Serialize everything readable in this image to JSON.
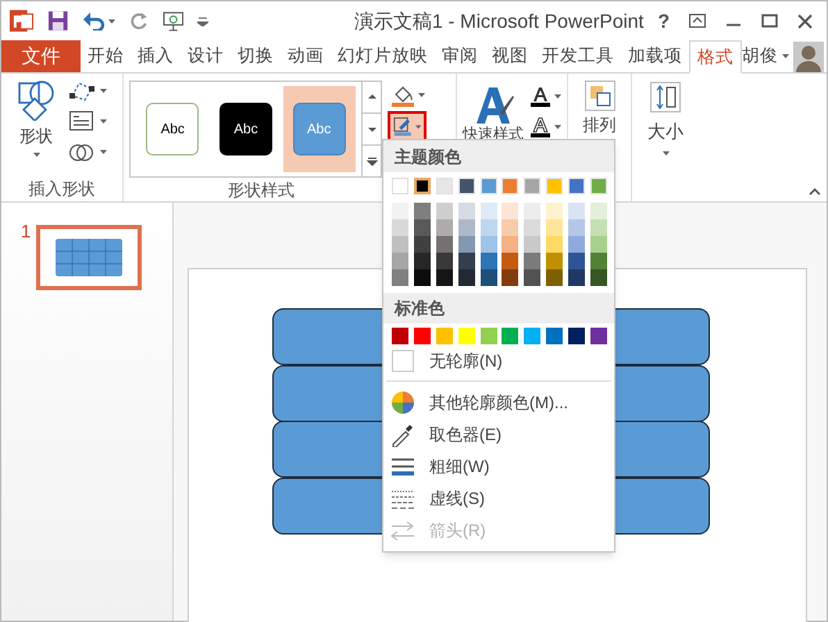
{
  "window": {
    "title": "演示文稿1 - Microsoft PowerPoint",
    "help": "?"
  },
  "ribbon_tabs": [
    {
      "label": "文件",
      "kind": "file",
      "selected": false
    },
    {
      "label": "开始",
      "kind": "tab",
      "selected": false
    },
    {
      "label": "插入",
      "kind": "tab",
      "selected": false
    },
    {
      "label": "设计",
      "kind": "tab",
      "selected": false
    },
    {
      "label": "切换",
      "kind": "tab",
      "selected": false
    },
    {
      "label": "动画",
      "kind": "tab",
      "selected": false
    },
    {
      "label": "幻灯片放映",
      "kind": "tab",
      "selected": false
    },
    {
      "label": "审阅",
      "kind": "tab",
      "selected": false
    },
    {
      "label": "视图",
      "kind": "tab",
      "selected": false
    },
    {
      "label": "开发工具",
      "kind": "tab",
      "selected": false
    },
    {
      "label": "加载项",
      "kind": "tab",
      "selected": false
    },
    {
      "label": "格式",
      "kind": "tab",
      "selected": true
    }
  ],
  "account": {
    "name": "胡俊"
  },
  "insert_shapes": {
    "button": "形状",
    "group": "插入形状"
  },
  "shape_styles": {
    "group": "形状样式",
    "gallery": [
      {
        "text": "Abc",
        "kind": "outline",
        "selected": false
      },
      {
        "text": "Abc",
        "kind": "dark",
        "selected": false
      },
      {
        "text": "Abc",
        "kind": "blue",
        "selected": true
      }
    ],
    "outline_button": {
      "expanded": true
    }
  },
  "quick_styles": {
    "label": "快速样式"
  },
  "arrange": {
    "label": "排列"
  },
  "size": {
    "label": "大小"
  },
  "outline_menu": {
    "theme_header": "主题颜色",
    "standard_header": "标准色",
    "theme_colors": [
      {
        "color": "#ffffff",
        "selected": false,
        "shades": [
          {
            "color": "#f2f2f2"
          },
          {
            "color": "#d9d9d9"
          },
          {
            "color": "#bfbfbf"
          },
          {
            "color": "#a6a6a6"
          },
          {
            "color": "#808080"
          }
        ]
      },
      {
        "color": "#000000",
        "selected": true,
        "shades": [
          {
            "color": "#7f7f7f"
          },
          {
            "color": "#595959"
          },
          {
            "color": "#404040"
          },
          {
            "color": "#262626"
          },
          {
            "color": "#0d0d0d"
          }
        ]
      },
      {
        "color": "#e7e6e6",
        "selected": false,
        "shades": [
          {
            "color": "#d0cece"
          },
          {
            "color": "#aeabab"
          },
          {
            "color": "#757171"
          },
          {
            "color": "#3b3838"
          },
          {
            "color": "#171616"
          }
        ]
      },
      {
        "color": "#44546a",
        "selected": false,
        "shades": [
          {
            "color": "#d6dce4"
          },
          {
            "color": "#adb9ca"
          },
          {
            "color": "#8497b0"
          },
          {
            "color": "#333f4f"
          },
          {
            "color": "#222a35"
          }
        ]
      },
      {
        "color": "#5b9bd5",
        "selected": false,
        "shades": [
          {
            "color": "#deebf6"
          },
          {
            "color": "#bdd7ee"
          },
          {
            "color": "#9dc3e6"
          },
          {
            "color": "#2e75b5"
          },
          {
            "color": "#1f4e79"
          }
        ]
      },
      {
        "color": "#ed7d31",
        "selected": false,
        "shades": [
          {
            "color": "#fbe5d5"
          },
          {
            "color": "#f7cbac"
          },
          {
            "color": "#f4b183"
          },
          {
            "color": "#c55a11"
          },
          {
            "color": "#833c0b"
          }
        ]
      },
      {
        "color": "#a5a5a5",
        "selected": false,
        "shades": [
          {
            "color": "#ededed"
          },
          {
            "color": "#dbdbdb"
          },
          {
            "color": "#c9c9c9"
          },
          {
            "color": "#7b7b7b"
          },
          {
            "color": "#525252"
          }
        ]
      },
      {
        "color": "#ffc000",
        "selected": false,
        "shades": [
          {
            "color": "#fff2cc"
          },
          {
            "color": "#fee599"
          },
          {
            "color": "#ffd965"
          },
          {
            "color": "#bf9000"
          },
          {
            "color": "#7f6000"
          }
        ]
      },
      {
        "color": "#4472c4",
        "selected": false,
        "shades": [
          {
            "color": "#dae3f3"
          },
          {
            "color": "#b4c7e7"
          },
          {
            "color": "#8faadc"
          },
          {
            "color": "#2f5496"
          },
          {
            "color": "#1f3864"
          }
        ]
      },
      {
        "color": "#70ad47",
        "selected": false,
        "shades": [
          {
            "color": "#e2efd9"
          },
          {
            "color": "#c5e0b3"
          },
          {
            "color": "#a8d08d"
          },
          {
            "color": "#538135"
          },
          {
            "color": "#375623"
          }
        ]
      }
    ],
    "standard_colors": [
      {
        "color": "#c00000"
      },
      {
        "color": "#ff0000"
      },
      {
        "color": "#ffc000"
      },
      {
        "color": "#ffff00"
      },
      {
        "color": "#92d050"
      },
      {
        "color": "#00b050"
      },
      {
        "color": "#00b0f0"
      },
      {
        "color": "#0070c0"
      },
      {
        "color": "#002060"
      },
      {
        "color": "#7030a0"
      }
    ],
    "items": [
      {
        "label": "无轮廓(N)",
        "kind": "none",
        "disabled": false
      },
      {
        "label": "其他轮廓颜色(M)...",
        "kind": "more",
        "disabled": false
      },
      {
        "label": "取色器(E)",
        "kind": "eyedropper",
        "disabled": false
      },
      {
        "label": "粗细(W)",
        "kind": "weight",
        "disabled": false
      },
      {
        "label": "虚线(S)",
        "kind": "dashes",
        "disabled": false
      },
      {
        "label": "箭头(R)",
        "kind": "arrows",
        "disabled": true
      }
    ]
  },
  "slides": [
    {
      "number": "1",
      "selected": true
    }
  ]
}
